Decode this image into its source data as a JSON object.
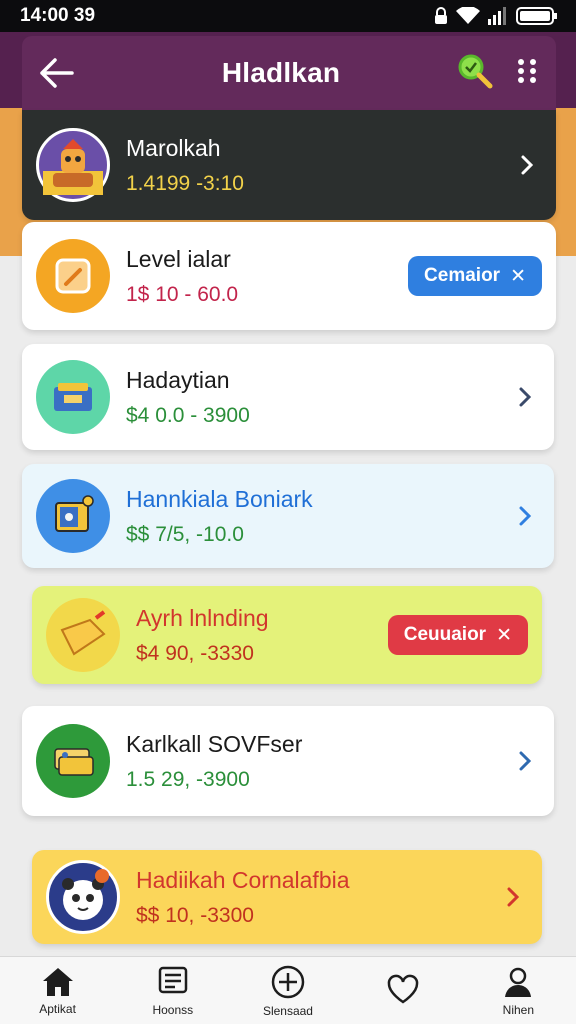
{
  "status_bar": {
    "time": "14:00 39"
  },
  "app_bar": {
    "title": "Hladlkan"
  },
  "items": [
    {
      "name": "Marolkah",
      "price_cur": "1.4",
      "price_rest": "1.4199 -3:10",
      "button": null
    },
    {
      "name": "Level ialar",
      "price_cur": "1$",
      "price_rest": "1$ 10 - 60.0",
      "button": "Cemaior"
    },
    {
      "name": "Hadaytian",
      "price_cur": "$4",
      "price_rest": "$4 0.0 - 3900",
      "button": null
    },
    {
      "name": "Hannkiala Boniark",
      "price_cur": "$$",
      "price_rest": "$$ 7/5, -10.0",
      "button": null
    },
    {
      "name": "Ayrh lnlnding",
      "price_cur": "$4",
      "price_rest": "$4 90, -3330",
      "button": "Ceuuaior"
    },
    {
      "name": "Karlkall SOVFser",
      "price_cur": "1.5",
      "price_rest": "1.5 29, -3900",
      "button": null
    },
    {
      "name": "Hadiikah Cornalafbia",
      "price_cur": "$$",
      "price_rest": "$$ 10, -3300",
      "button": null
    }
  ],
  "nav": [
    {
      "label": "Aptikat",
      "icon": "home-icon"
    },
    {
      "label": "Hoonss",
      "icon": "list-icon"
    },
    {
      "label": "Slensaad",
      "icon": "plus-circle-icon"
    },
    {
      "label": "",
      "icon": "heart-icon"
    },
    {
      "label": "Nihen",
      "icon": "profile-icon"
    }
  ],
  "colors": {
    "app_bar": "#632a5b",
    "band_purple": "#55214f",
    "band_orange": "#e9a24a",
    "blue_button": "#2f7fe0",
    "red_button": "#e03a45",
    "price_green": "#2b8f3a",
    "price_red": "#c2244b",
    "name_blue": "#1f6fd6",
    "name_red": "#d2362d"
  }
}
